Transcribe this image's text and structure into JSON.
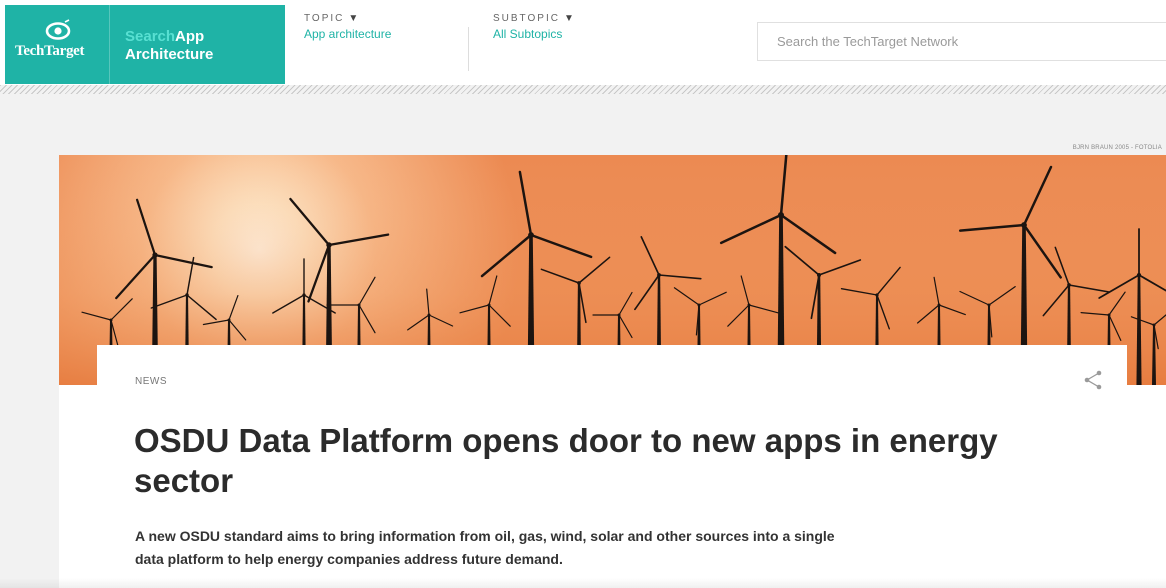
{
  "brand": {
    "logo_text": "TechTarget",
    "site_name_prefix": "Search",
    "site_name_line1": "App",
    "site_name_line2": "Architecture",
    "color": "#1fb3a6"
  },
  "nav": {
    "topic_label": "TOPIC",
    "topic_value": "App architecture",
    "subtopic_label": "SUBTOPIC",
    "subtopic_value": "All Subtopics",
    "caret_icon": "caret-down-icon"
  },
  "search": {
    "placeholder": "Search the TechTarget Network"
  },
  "hero": {
    "credit": "BJRN BRAUN 2005 - FOTOLIA"
  },
  "article": {
    "kicker": "NEWS",
    "headline": "OSDU Data Platform opens door to new apps in energy sector",
    "dek": "A new OSDU standard aims to bring information from oil, gas, wind, solar and other sources into a single data platform to help energy companies address future demand.",
    "share_icon": "share-icon"
  }
}
